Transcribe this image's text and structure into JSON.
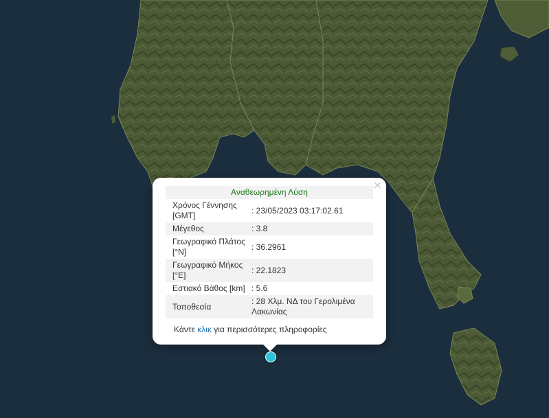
{
  "map": {
    "colors": {
      "sea": "#1b2e3e",
      "land": "#4a5a34",
      "land_dark": "#3a4a2a",
      "coast": "#6b7550"
    }
  },
  "popup": {
    "header": "Αναθεωρημένη Λύση",
    "rows": [
      {
        "label": "Χρόνος Γέννησης [GMT]",
        "value": ": 23/05/2023 03:17:02.61"
      },
      {
        "label": "Μέγεθος",
        "value": ": 3.8"
      },
      {
        "label": "Γεωγραφικό Πλάτος [°N]",
        "value": ": 36.2961"
      },
      {
        "label": "Γεωγραφικό Μήκος [°E]",
        "value": ": 22.1823"
      },
      {
        "label": "Εστιακό Βάθος [km]",
        "value": ": 5.6"
      },
      {
        "label": "Τοποθεσία",
        "value": ": 28 Χλμ. ΝΔ του Γερολιμένα Λακωνίας"
      }
    ],
    "more_prefix": "Κάντε ",
    "more_link": "κλικ",
    "more_suffix": " για περισσότερες πληροφορίες",
    "close_label": "×"
  },
  "marker": {
    "color": "#2bc4d6"
  }
}
